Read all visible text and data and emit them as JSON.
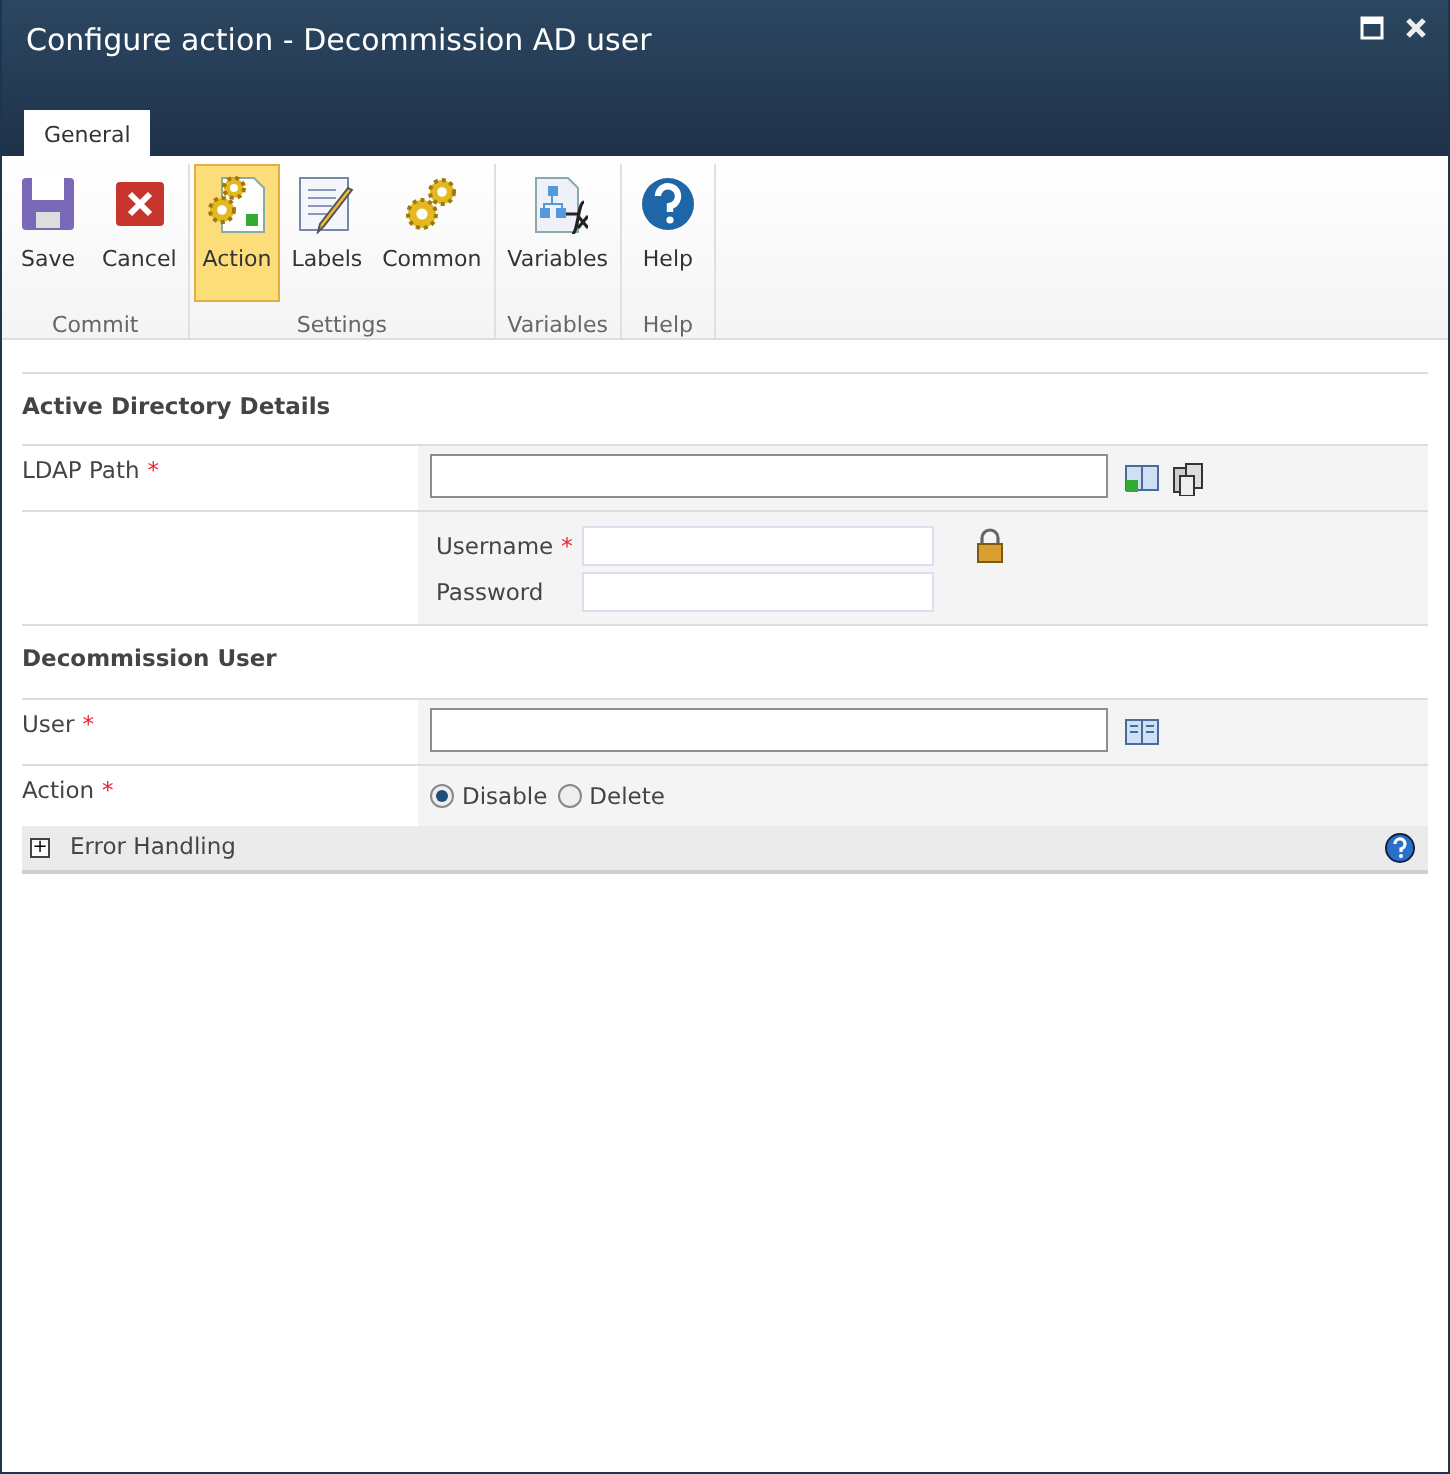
{
  "window": {
    "title": "Configure action - Decommission AD user"
  },
  "tabs": [
    {
      "label": "General",
      "selected": true
    }
  ],
  "ribbon": [
    {
      "label": "Commit",
      "buttons": [
        {
          "label": "Save",
          "selected": false
        },
        {
          "label": "Cancel",
          "selected": false
        }
      ]
    },
    {
      "label": "Settings",
      "buttons": [
        {
          "label": "Action",
          "selected": true
        },
        {
          "label": "Labels",
          "selected": false
        },
        {
          "label": "Common",
          "selected": false
        }
      ]
    },
    {
      "label": "Variables",
      "buttons": [
        {
          "label": "Variables",
          "selected": false
        }
      ]
    },
    {
      "label": "Help",
      "buttons": [
        {
          "label": "Help",
          "selected": false
        }
      ]
    }
  ],
  "sections": [
    {
      "title": "Active Directory Details",
      "rows": [
        {
          "kind": "text",
          "label": "LDAP Path",
          "required_mark": "*"
        },
        {
          "kind": "credentials",
          "fields": [
            {
              "label": "Username",
              "required_mark": "*"
            },
            {
              "label": "Password"
            }
          ]
        }
      ]
    },
    {
      "title": "Decommission User",
      "rows": [
        {
          "kind": "text",
          "label": "User",
          "required_mark": "*"
        },
        {
          "kind": "radio",
          "label": "Action",
          "required_mark": "*",
          "options": [
            {
              "label": "Disable",
              "selected": true
            },
            {
              "label": "Delete",
              "selected": false
            }
          ]
        }
      ]
    }
  ],
  "collapsible": {
    "toggle": "+",
    "label": "Error Handling",
    "expanded": false
  }
}
